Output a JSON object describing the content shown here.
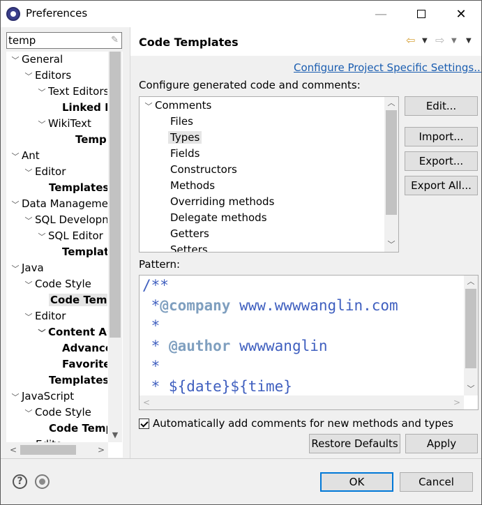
{
  "window": {
    "title": "Preferences"
  },
  "filter": {
    "value": "temp"
  },
  "tree": {
    "items": [
      {
        "label": "General",
        "expanded": true,
        "bold": false
      },
      {
        "label": "Editors",
        "expanded": true,
        "bold": false
      },
      {
        "label": "Text Editors",
        "expanded": true,
        "bold": false
      },
      {
        "label": "Linked M",
        "bold": true
      },
      {
        "label": "WikiText",
        "expanded": true,
        "bold": false
      },
      {
        "label": "Templ",
        "bold": true
      },
      {
        "label": "Ant",
        "expanded": true,
        "bold": false
      },
      {
        "label": "Editor",
        "expanded": true,
        "bold": false
      },
      {
        "label": "Templates",
        "bold": true
      },
      {
        "label": "Data Manageme",
        "expanded": true,
        "bold": false
      },
      {
        "label": "SQL Developn",
        "expanded": true,
        "bold": false
      },
      {
        "label": "SQL Editor",
        "expanded": true,
        "bold": false
      },
      {
        "label": "Templat",
        "bold": true
      },
      {
        "label": "Java",
        "expanded": true,
        "bold": false
      },
      {
        "label": "Code Style",
        "expanded": true,
        "bold": false
      },
      {
        "label": "Code Temp",
        "bold": true,
        "selected": true
      },
      {
        "label": "Editor",
        "expanded": true,
        "bold": false
      },
      {
        "label": "Content As",
        "expanded": true,
        "bold": true
      },
      {
        "label": "Advance",
        "bold": true
      },
      {
        "label": "Favorites",
        "bold": true
      },
      {
        "label": "Templates",
        "bold": true
      },
      {
        "label": "JavaScript",
        "expanded": true,
        "bold": false
      },
      {
        "label": "Code Style",
        "expanded": true,
        "bold": false
      },
      {
        "label": "Code Temp",
        "bold": true
      },
      {
        "label": "Edito",
        "bold": false
      }
    ]
  },
  "page": {
    "title": "Code Templates",
    "project_link": "Configure Project Specific Settings...",
    "description": "Configure generated code and comments:"
  },
  "categories": {
    "root": "Comments",
    "items": [
      "Files",
      "Types",
      "Fields",
      "Constructors",
      "Methods",
      "Overriding methods",
      "Delegate methods",
      "Getters",
      "Setters"
    ],
    "selected": "Types"
  },
  "side_buttons": {
    "edit": "Edit...",
    "import": "Import...",
    "export": "Export...",
    "export_all": "Export All..."
  },
  "pattern": {
    "label": "Pattern:",
    "lines": [
      {
        "text": "/**",
        "tag": "",
        "rest": ""
      },
      {
        "text": " *",
        "tag": "@company",
        "rest": " www.wwwwanglin.com"
      },
      {
        "text": " *",
        "tag": "",
        "rest": ""
      },
      {
        "text": " * ",
        "tag": "@author",
        "rest": " wwwwanglin"
      },
      {
        "text": " *",
        "tag": "",
        "rest": ""
      },
      {
        "text": " * ${date}${time}",
        "tag": "",
        "rest": ""
      }
    ]
  },
  "auto_comments": {
    "label": "Automatically add comments for new methods and types",
    "checked": true
  },
  "buttons": {
    "restore": "Restore Defaults",
    "apply": "Apply",
    "ok": "OK",
    "cancel": "Cancel"
  },
  "icons": {
    "help": "?",
    "back": "⇦",
    "forward": "⇨"
  }
}
